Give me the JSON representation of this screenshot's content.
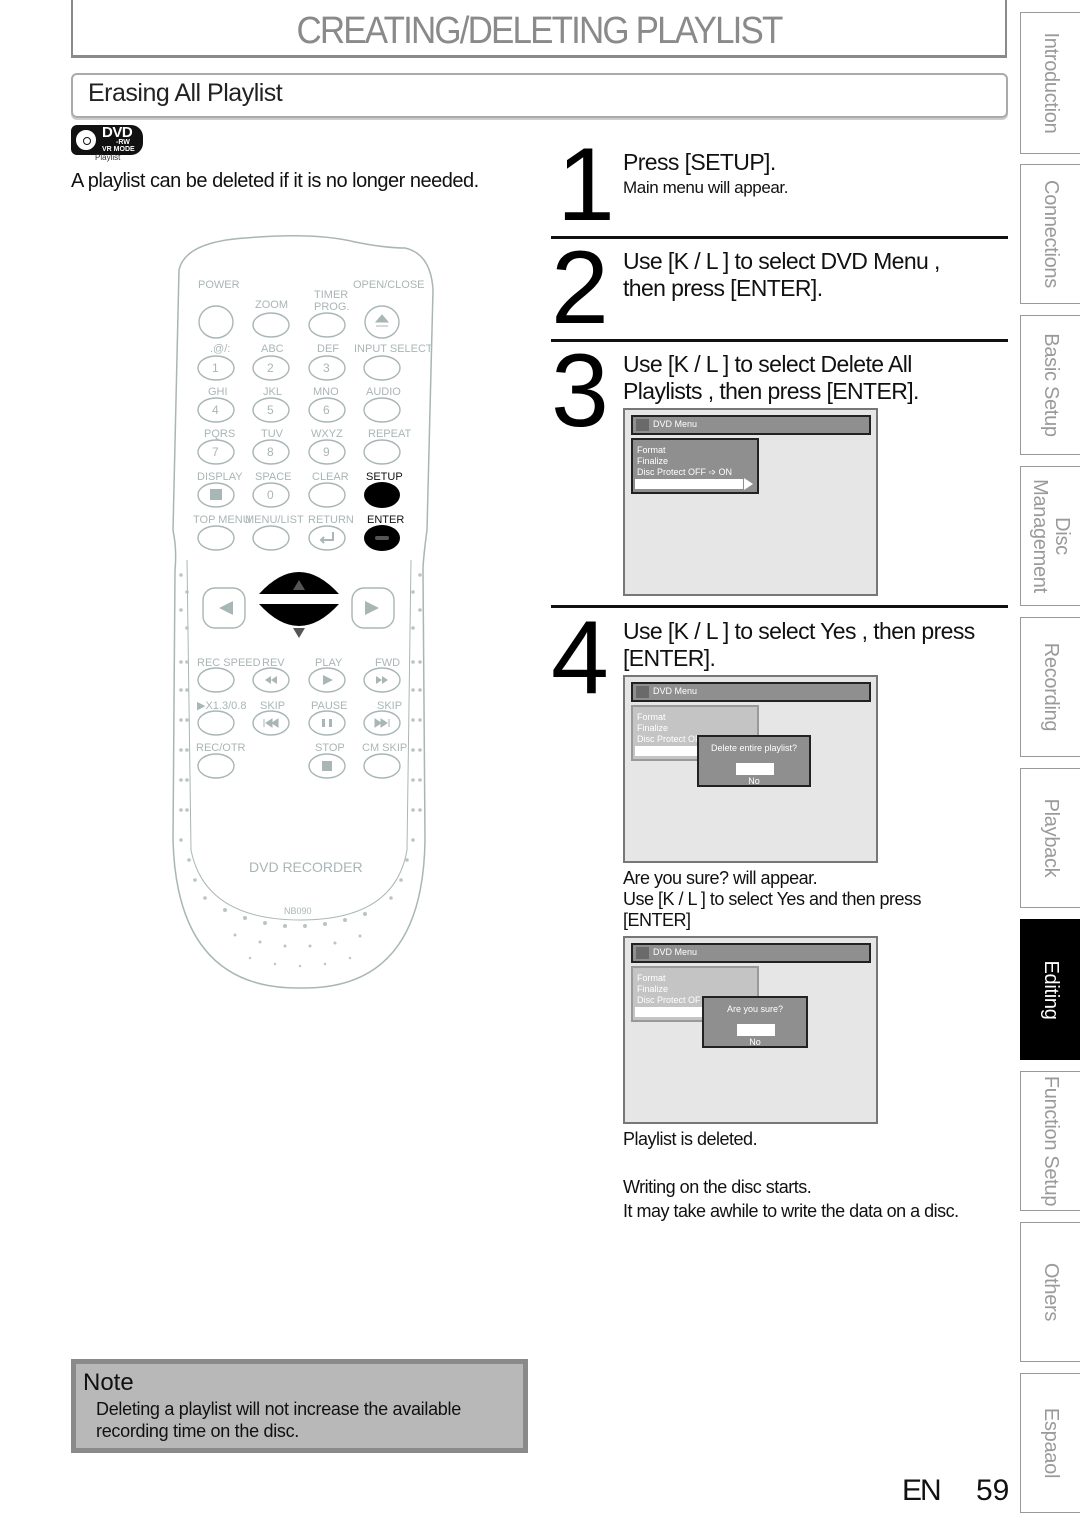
{
  "page": {
    "title": "CREATING/DELETING PLAYLIST",
    "section_title": "Erasing All Playlist",
    "badge": {
      "disc": "DVD",
      "format": "-RW",
      "mode": "VR MODE",
      "label": "Playlist"
    },
    "intro": "A playlist can be deleted if it is no longer needed."
  },
  "remote": {
    "labels": {
      "power": "POWER",
      "open_close": "OPEN/CLOSE",
      "zoom": "ZOOM",
      "timer": "TIMER",
      "prog": "PROG.",
      "k1": ".@/:",
      "k2": "ABC",
      "k3": "DEF",
      "input_select": "INPUT SELECT",
      "k4": "GHI",
      "k5": "JKL",
      "k6": "MNO",
      "audio": "AUDIO",
      "k7": "PQRS",
      "k8": "TUV",
      "k9": "WXYZ",
      "repeat": "REPEAT",
      "display": "DISPLAY",
      "space": "SPACE",
      "clear": "CLEAR",
      "setup": "SETUP",
      "top_menu": "TOP MENU",
      "menu_list": "MENU/LIST",
      "return": "RETURN",
      "enter": "ENTER",
      "rec_speed": "REC SPEED",
      "rev": "REV",
      "play": "PLAY",
      "fwd": "FWD",
      "speed": "▶X1.3/0.8",
      "skip_back": "SKIP",
      "pause": "PAUSE",
      "skip_fwd": "SKIP",
      "rec_otr": "REC/OTR",
      "stop": "STOP",
      "cm_skip": "CM SKIP",
      "brand": "DVD RECORDER",
      "model": "NB090"
    },
    "digits": [
      "1",
      "2",
      "3",
      "4",
      "5",
      "6",
      "7",
      "8",
      "9",
      "0"
    ]
  },
  "steps": [
    {
      "number": "1",
      "title": "Press [SETUP].",
      "subtitle": "Main menu will appear."
    },
    {
      "number": "2",
      "title_line1": "Use [K / L ] to select   DVD Menu  ,",
      "title_line2": "then press [ENTER]."
    },
    {
      "number": "3",
      "title_line1": "Use [K / L ] to select   Delete All",
      "title_line2": "Playlists  , then press [ENTER]."
    },
    {
      "number": "4",
      "title_line1": "Use [K / L ] to select   Yes  , then press",
      "title_line2": "[ENTER]."
    }
  ],
  "screens": {
    "menu_title": "DVD Menu",
    "items": [
      "Format",
      "Finalize",
      "Disc Protect OFF ➩ ON"
    ],
    "item3_trunc": "Disc Protect OF",
    "dialog1": {
      "question": "Delete entire playlist?",
      "option_no": "No"
    },
    "dialog2": {
      "question": "Are you sure?",
      "option_no": "No"
    }
  },
  "step4_texts": {
    "confirm1": " Are you sure?  will appear.",
    "confirm2": "Use [K / L ] to select   Yes  and then press",
    "confirm3": "[ENTER]",
    "result1": "Playlist is deleted.",
    "result2": "Writing on the disc starts.",
    "result3": "It may take awhile to write the data on a disc."
  },
  "note": {
    "title": "Note",
    "line1": "Deleting a playlist will not increase the available",
    "line2": "recording time on the disc."
  },
  "side_tabs": [
    {
      "label": "Introduction",
      "active": false
    },
    {
      "label": "Connections",
      "active": false
    },
    {
      "label": "Basic Setup",
      "active": false
    },
    {
      "label": "Disc\nManagement",
      "active": false
    },
    {
      "label": "Recording",
      "active": false
    },
    {
      "label": "Playback",
      "active": false
    },
    {
      "label": "Editing",
      "active": true
    },
    {
      "label": "Function Setup",
      "active": false
    },
    {
      "label": "Others",
      "active": false
    },
    {
      "label": "Espaaol",
      "active": false
    }
  ],
  "footer": {
    "lang": "EN",
    "page_number": "59"
  }
}
